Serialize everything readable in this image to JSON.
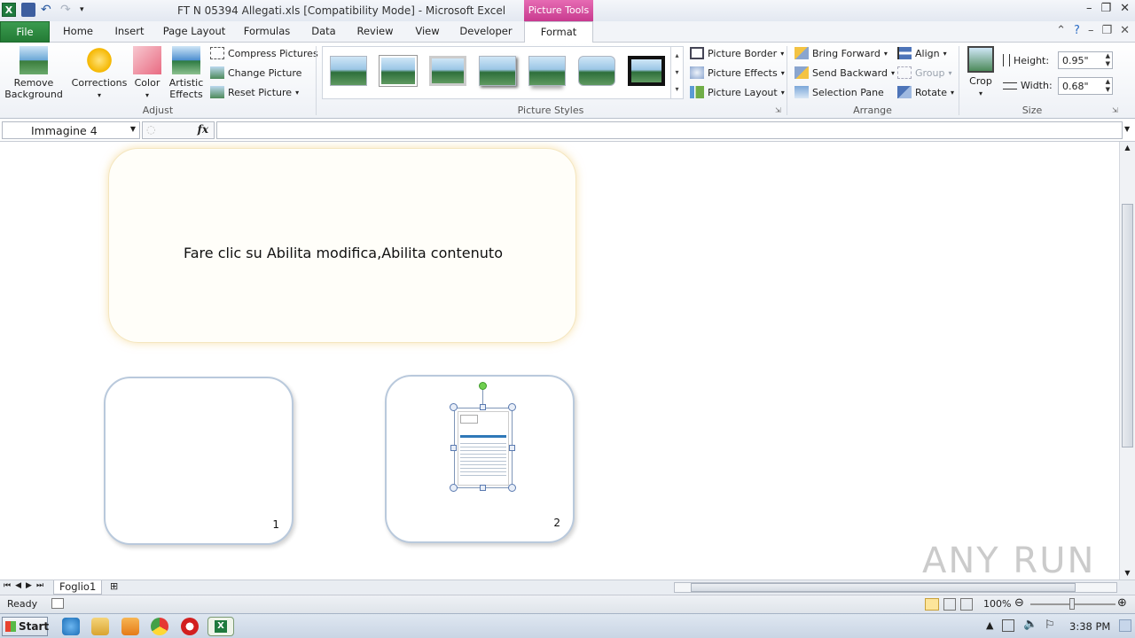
{
  "titlebar": {
    "document_title": "FT N 05394 Allegati.xls  [Compatibility Mode]  -  Microsoft Excel",
    "context_tab_group": "Picture Tools"
  },
  "tabs": [
    "File",
    "Home",
    "Insert",
    "Page Layout",
    "Formulas",
    "Data",
    "Review",
    "View",
    "Developer",
    "Format"
  ],
  "ribbon": {
    "adjust": {
      "remove_background": "Remove Background",
      "corrections": "Corrections",
      "color": "Color",
      "artistic_effects": "Artistic Effects",
      "compress_pictures": "Compress Pictures",
      "change_picture": "Change Picture",
      "reset_picture": "Reset Picture",
      "group_label": "Adjust"
    },
    "picture_styles": {
      "group_label": "Picture Styles",
      "picture_border": "Picture Border",
      "picture_effects": "Picture Effects",
      "picture_layout": "Picture Layout"
    },
    "arrange": {
      "bring_forward": "Bring Forward",
      "send_backward": "Send Backward",
      "selection_pane": "Selection Pane",
      "align": "Align",
      "group": "Group",
      "rotate": "Rotate",
      "group_label": "Arrange"
    },
    "size": {
      "crop": "Crop",
      "height_label": "Height:",
      "height_value": "0.95\"",
      "width_label": "Width:",
      "width_value": "0.68\"",
      "group_label": "Size"
    }
  },
  "formula_bar": {
    "name_box": "Immagine 4",
    "fx": "fx",
    "formula": ""
  },
  "sheet": {
    "banner_text": "Fare clic su Abilita modifica,Abilita contenuto",
    "card1_number": "1",
    "card2_number": "2"
  },
  "sheet_tabs": {
    "active": "Foglio1"
  },
  "status": {
    "ready": "Ready",
    "zoom": "100%"
  },
  "taskbar": {
    "start": "Start",
    "clock": "3:38 PM"
  },
  "watermark": "ANY RUN"
}
